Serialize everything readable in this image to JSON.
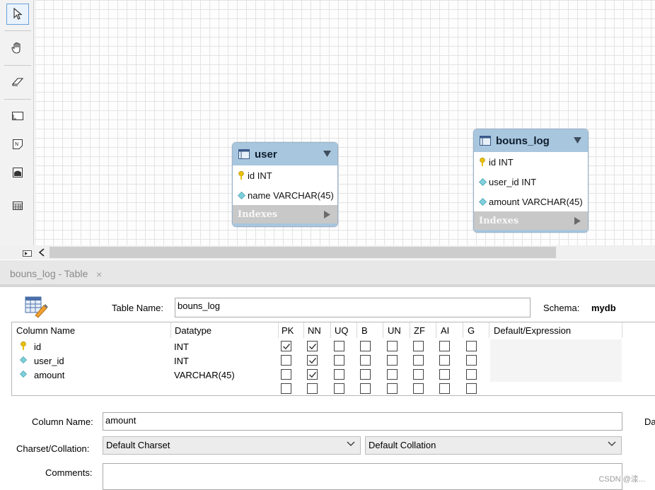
{
  "toolbar": {
    "tools": [
      {
        "name": "pointer-icon",
        "selected": true
      },
      {
        "name": "hand-icon"
      },
      {
        "name": "eraser-icon"
      },
      {
        "name": "layer-icon"
      },
      {
        "name": "note-icon"
      },
      {
        "name": "image-icon"
      },
      {
        "name": "table-icon"
      }
    ]
  },
  "diagram": {
    "entities": [
      {
        "title": "user",
        "columns": [
          {
            "text": "id INT",
            "key": "primary"
          },
          {
            "text": "name VARCHAR(45)",
            "key": "column"
          }
        ],
        "indexes_label": "Indexes"
      },
      {
        "title": "bouns_log",
        "columns": [
          {
            "text": "id INT",
            "key": "primary"
          },
          {
            "text": "user_id INT",
            "key": "column"
          },
          {
            "text": "amount VARCHAR(45)",
            "key": "column"
          }
        ],
        "indexes_label": "Indexes"
      }
    ]
  },
  "tab": {
    "label": "bouns_log - Table",
    "close": "×"
  },
  "editor": {
    "table_name_label": "Table Name:",
    "table_name_value": "bouns_log",
    "schema_label": "Schema:",
    "schema_value": "mydb",
    "grid": {
      "headers": [
        "Column Name",
        "Datatype",
        "PK",
        "NN",
        "UQ",
        "B",
        "UN",
        "ZF",
        "AI",
        "G",
        "Default/Expression"
      ],
      "rows": [
        {
          "name": "id",
          "key": "primary",
          "datatype": "INT",
          "flags": [
            true,
            true,
            false,
            false,
            false,
            false,
            false,
            false
          ]
        },
        {
          "name": "user_id",
          "key": "column",
          "datatype": "INT",
          "flags": [
            false,
            true,
            false,
            false,
            false,
            false,
            false,
            false
          ]
        },
        {
          "name": "amount",
          "key": "column",
          "datatype": "VARCHAR(45)",
          "flags": [
            false,
            true,
            false,
            false,
            false,
            false,
            false,
            false
          ]
        },
        {
          "name": "",
          "key": "none",
          "datatype": "",
          "flags": [
            false,
            false,
            false,
            false,
            false,
            false,
            false,
            false
          ]
        }
      ]
    },
    "column_name_label": "Column Name:",
    "column_name_value": "amount",
    "truncated_label": "Da",
    "charset_label": "Charset/Collation:",
    "charset_value": "Default Charset",
    "collation_value": "Default Collation",
    "comments_label": "Comments:"
  },
  "watermark": "CSDN @渁..."
}
